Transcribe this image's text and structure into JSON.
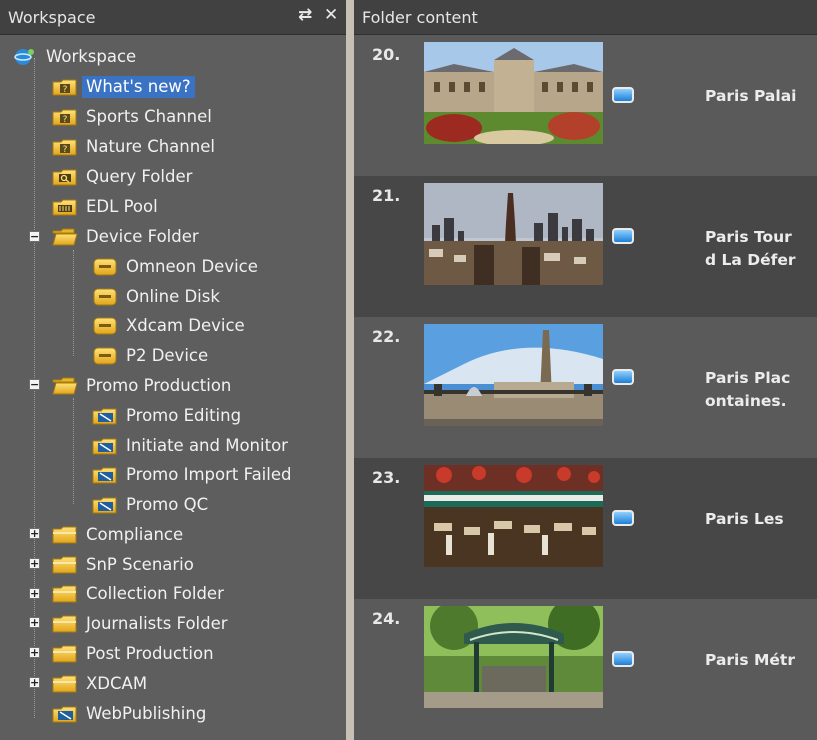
{
  "workspace_panel": {
    "title": "Workspace",
    "refresh_icon": "refresh-icon",
    "close_icon": "close-icon",
    "nodes": [
      {
        "label": "Workspace",
        "icon": "workspace-globe-icon"
      },
      {
        "label": "What's new?",
        "icon": "special-folder-icon",
        "selected": true
      },
      {
        "label": "Sports Channel",
        "icon": "special-folder-icon"
      },
      {
        "label": "Nature Channel",
        "icon": "special-folder-icon"
      },
      {
        "label": "Query Folder",
        "icon": "query-folder-icon"
      },
      {
        "label": "EDL Pool",
        "icon": "edl-folder-icon"
      },
      {
        "label": "Device Folder",
        "icon": "open-folder-icon",
        "expanded": true
      },
      {
        "label": "Omneon Device",
        "icon": "device-icon"
      },
      {
        "label": "Online Disk",
        "icon": "device-icon"
      },
      {
        "label": "Xdcam Device",
        "icon": "device-icon"
      },
      {
        "label": "P2 Device",
        "icon": "device-icon"
      },
      {
        "label": "Promo Production",
        "icon": "open-folder-icon",
        "expanded": true
      },
      {
        "label": "Promo Editing",
        "icon": "workflow-folder-icon"
      },
      {
        "label": "Initiate and Monitor",
        "icon": "workflow-folder-icon"
      },
      {
        "label": "Promo Import Failed",
        "icon": "workflow-folder-icon"
      },
      {
        "label": "Promo QC",
        "icon": "workflow-folder-icon"
      },
      {
        "label": "Compliance",
        "icon": "folder-icon",
        "expanded": false
      },
      {
        "label": "SnP Scenario",
        "icon": "folder-icon",
        "expanded": false
      },
      {
        "label": "Collection Folder",
        "icon": "folder-icon",
        "expanded": false
      },
      {
        "label": "Journalists Folder",
        "icon": "folder-icon",
        "expanded": false
      },
      {
        "label": "Post Production",
        "icon": "folder-icon",
        "expanded": false
      },
      {
        "label": "XDCAM",
        "icon": "folder-icon",
        "expanded": false
      },
      {
        "label": "WebPublishing",
        "icon": "workflow-folder-icon"
      }
    ]
  },
  "folder_content": {
    "title": "Folder content",
    "rows": [
      {
        "number": "20.",
        "title_lines": [
          "Paris Palai"
        ],
        "thumb": "palace-thumbnail"
      },
      {
        "number": "21.",
        "title_lines": [
          "Paris Tour",
          "d La Défer"
        ],
        "thumb": "skyline-thumbnail"
      },
      {
        "number": "22.",
        "title_lines": [
          "Paris Plac",
          "ontaines."
        ],
        "thumb": "obelisk-thumbnail"
      },
      {
        "number": "23.",
        "title_lines": [
          "Paris Les"
        ],
        "thumb": "cafe-thumbnail"
      },
      {
        "number": "24.",
        "title_lines": [
          "Paris Métr"
        ],
        "thumb": "metro-thumbnail"
      }
    ],
    "badge_icon": "clip-status-icon"
  },
  "colors": {
    "panel_bg": "#5e5e5e",
    "header_bg": "#414141",
    "selection": "#3b73c4",
    "folder_yellow": "#f2c232",
    "splitter": "#c6c1b4"
  }
}
